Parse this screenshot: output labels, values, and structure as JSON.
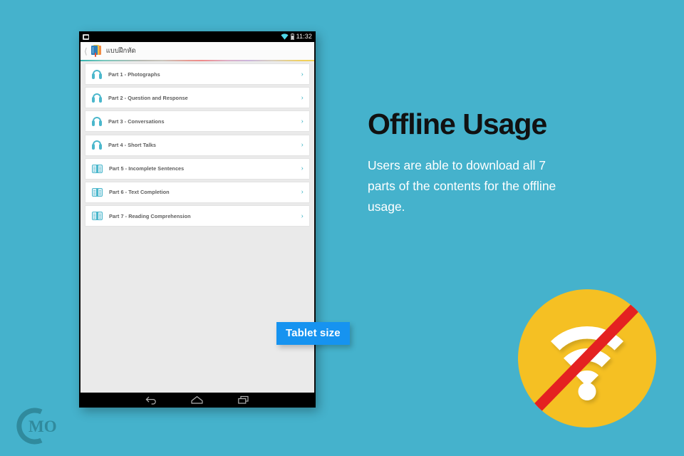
{
  "palette": {
    "background": "#45B2CC",
    "accent_teal": "#4BB7CC",
    "badge_blue": "#1693F0",
    "wifi_yellow": "#F5C023",
    "wifi_slash_red": "#E42121",
    "list_bg": "#EAEAEA",
    "card_white": "#FFFFFF",
    "heading_black": "#111111"
  },
  "device": {
    "status_bar": {
      "screenshot_icon": "screenshot-icon",
      "wifi_icon": "wifi-icon",
      "battery_icon": "battery-icon",
      "time": "11:32"
    },
    "app_bar": {
      "back_chevron": "chevron-left-icon",
      "app_icon": "books-icon",
      "title": "แบบฝึกหัด"
    },
    "nav_bar": {
      "back": "back-arrow-icon",
      "home": "home-icon",
      "recents": "recent-apps-icon"
    }
  },
  "list": {
    "items": [
      {
        "label": "Part 1 - Photographs",
        "icon": "headphones-icon",
        "chevron": "›"
      },
      {
        "label": "Part 2 - Question and Response",
        "icon": "headphones-icon",
        "chevron": "›"
      },
      {
        "label": "Part 3 - Conversations",
        "icon": "headphones-icon",
        "chevron": "›"
      },
      {
        "label": "Part 4 - Short Talks",
        "icon": "headphones-icon",
        "chevron": "›"
      },
      {
        "label": "Part 5 - Incomplete Sentences",
        "icon": "open-book-icon",
        "chevron": "›"
      },
      {
        "label": "Part 6 - Text Completion",
        "icon": "open-book-icon",
        "chevron": "›"
      },
      {
        "label": "Part 7 - Reading Comprehension",
        "icon": "open-book-icon",
        "chevron": "›"
      }
    ]
  },
  "feature": {
    "heading": "Offline Usage",
    "body": "Users are able to download all 7 parts of the contents for the offline usage."
  },
  "badge": {
    "label": "Tablet size"
  },
  "wifi_off": {
    "icon": "wifi-off-icon"
  },
  "logo": {
    "text": "CMO"
  }
}
